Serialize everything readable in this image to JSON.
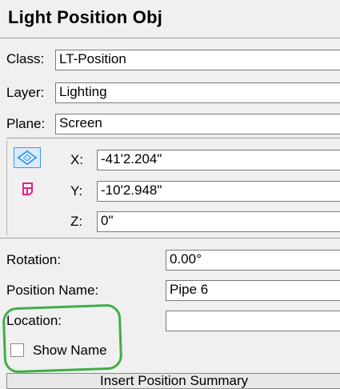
{
  "title": "Light Position Obj",
  "general": {
    "class_label": "Class:",
    "class_value": "LT-Position",
    "layer_label": "Layer:",
    "layer_value": "Lighting",
    "plane_label": "Plane:",
    "plane_value": "Screen"
  },
  "coords": {
    "x_label": "X:",
    "x_value": "-41'2.204\"",
    "y_label": "Y:",
    "y_value": "-10'2.948\"",
    "z_label": "Z:",
    "z_value": "0\""
  },
  "props": {
    "rotation_label": "Rotation:",
    "rotation_value": "0.00°",
    "position_name_label": "Position Name:",
    "position_name_value": "Pipe 6",
    "location_label": "Location:",
    "location_value": "",
    "show_name_label": "Show Name",
    "show_name_checked": false
  },
  "summary_button_label": "Insert Position Summary",
  "colors": {
    "annotation": "#3fae49",
    "icon_accent": "#3399ff",
    "icon_pink": "#e0218a"
  }
}
